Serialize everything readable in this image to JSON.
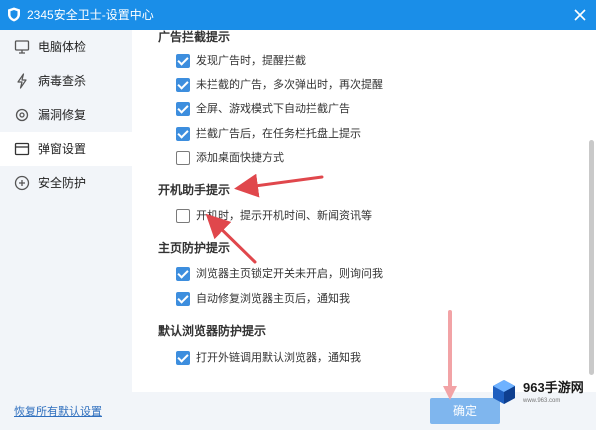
{
  "window": {
    "title": "2345安全卫士-设置中心",
    "title_bar_color": "#1a8ee8"
  },
  "sidebar": {
    "items": [
      {
        "label": "电脑体检",
        "icon": "monitor-icon",
        "active": false
      },
      {
        "label": "病毒查杀",
        "icon": "lightning-icon",
        "active": false
      },
      {
        "label": "漏洞修复",
        "icon": "repair-icon",
        "active": false
      },
      {
        "label": "弹窗设置",
        "icon": "popup-window-icon",
        "active": true
      },
      {
        "label": "安全防护",
        "icon": "shield-plus-icon",
        "active": false
      }
    ],
    "restore_label": "恢复所有默认设置"
  },
  "sections": {
    "ad_block": {
      "title": "广告拦截提示",
      "options": [
        {
          "label": "发现广告时，提醒拦截",
          "checked": true
        },
        {
          "label": "未拦截的广告，多次弹出时，再次提醒",
          "checked": true
        },
        {
          "label": "全屏、游戏模式下自动拦截广告",
          "checked": true
        },
        {
          "label": "拦截广告后，在任务栏托盘上提示",
          "checked": true
        },
        {
          "label": "添加桌面快捷方式",
          "checked": false
        }
      ]
    },
    "boot_assistant": {
      "title": "开机助手提示",
      "options": [
        {
          "label": "开机时，提示开机时间、新闻资讯等",
          "checked": false
        }
      ]
    },
    "homepage": {
      "title": "主页防护提示",
      "options": [
        {
          "label": "浏览器主页锁定开关未开启，则询问我",
          "checked": true
        },
        {
          "label": "自动修复浏览器主页后，通知我",
          "checked": true
        }
      ]
    },
    "default_browser": {
      "title": "默认浏览器防护提示",
      "options": [
        {
          "label": "打开外链调用默认浏览器，通知我",
          "checked": true
        }
      ]
    }
  },
  "footer": {
    "confirm_label": "确定"
  },
  "watermark": {
    "text": "963手游网",
    "sub": "www.963.com"
  },
  "colors": {
    "accent": "#1a8ee8",
    "checkbox_checked": "#3d8ede",
    "sidebar_bg": "#f2f5f9",
    "annotation_arrow": "#e0474c",
    "confirm_button": "#7fb6ee"
  }
}
